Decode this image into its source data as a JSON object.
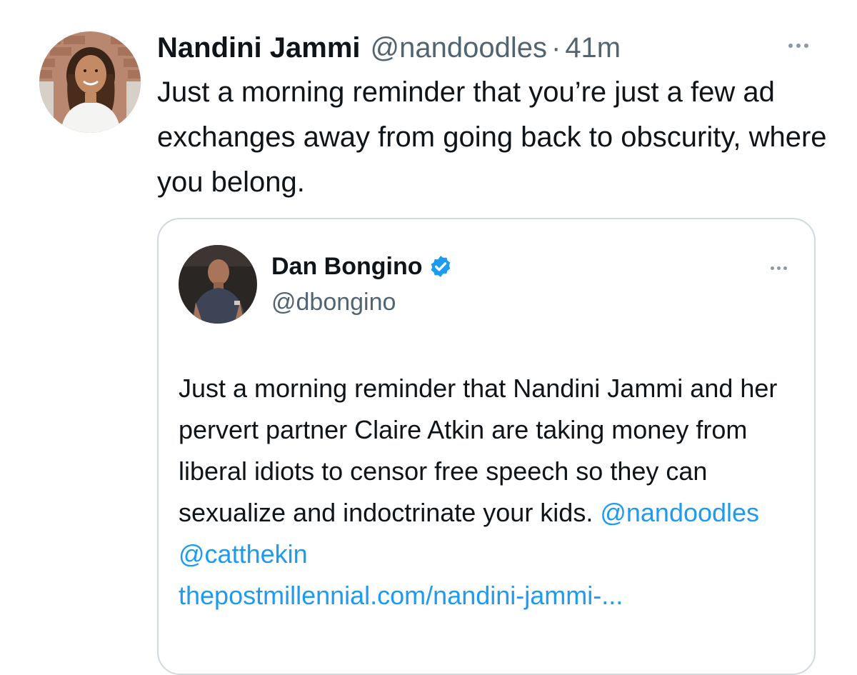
{
  "tweet": {
    "author_name": "Nandini Jammi",
    "author_handle": "@nandoodles",
    "separator": "·",
    "timestamp": "41m",
    "text": "Just a morning reminder that you’re just a few ad exchanges away from going back to obscurity, where you belong."
  },
  "quoted_tweet": {
    "author_name": "Dan Bongino",
    "author_handle": "@dbongino",
    "verified": true,
    "text": "Just a morning reminder that Nandini Jammi and her pervert partner Claire Atkin are taking money from liberal idiots to censor free speech so they can sexualize and indoctrinate your kids.",
    "mentions": [
      "@nandoodles",
      "@catthekin"
    ],
    "link_text": "thepostmillennial.com/nandini-jammi-..."
  },
  "colors": {
    "text_primary": "#0f1419",
    "text_secondary": "#536471",
    "link": "#1d9bf0",
    "border": "#cfd9de",
    "verified_badge": "#1d9bf0"
  },
  "icons": {
    "more": "more-dots-icon",
    "verified": "verified-badge-icon"
  }
}
